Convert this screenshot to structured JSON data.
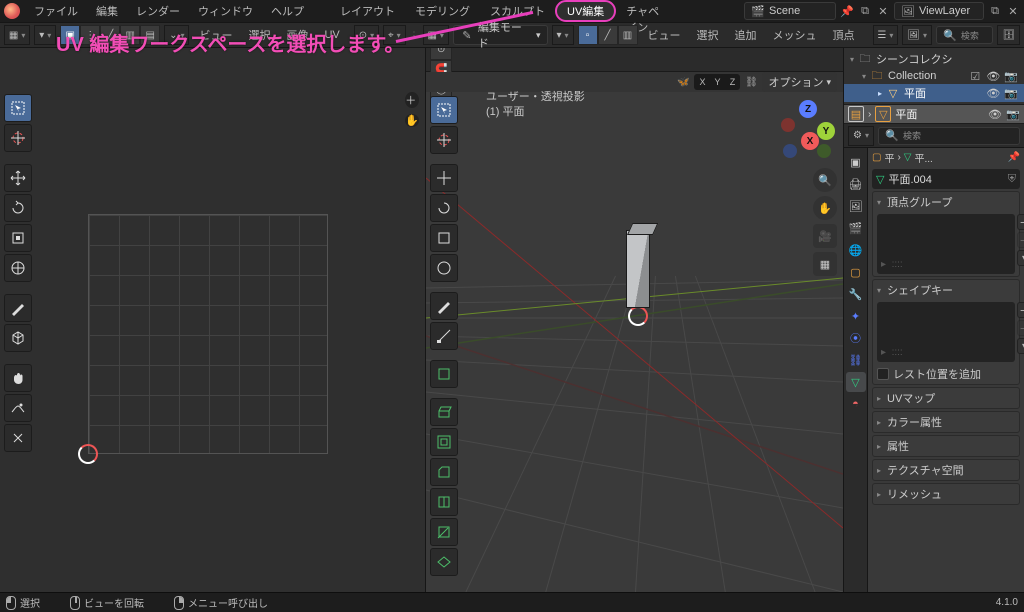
{
  "menu": {
    "file": "ファイル",
    "edit": "編集",
    "render": "レンダー",
    "window": "ウィンドウ",
    "help": "ヘルプ"
  },
  "workspaces": {
    "layout": "レイアウト",
    "modeling": "モデリング",
    "sculpt": "スカルプト",
    "uv": "UV編集",
    "texpaint": "テクスチャペイン"
  },
  "scene": {
    "label": "Scene"
  },
  "viewlayer": {
    "label": "ViewLayer"
  },
  "uv_header": {
    "view": "ビュー",
    "select": "選択",
    "image": "画像",
    "uv": "UV"
  },
  "vp_header": {
    "mode": "編集モード",
    "view": "ビュー",
    "select": "選択",
    "add": "追加",
    "mesh": "メッシュ",
    "vertex": "頂点"
  },
  "options_label": "オプション",
  "axes": {
    "x": "X",
    "y": "Y",
    "z": "Z"
  },
  "viewport": {
    "title": "ユーザー・透視投影",
    "object": "(1) 平面"
  },
  "outliner": {
    "search_placeholder": "検索",
    "scene_coll": "シーンコレクシ",
    "collection": "Collection",
    "object": "平面"
  },
  "new_editor": {
    "name": "平面"
  },
  "props_tabs": [
    "render",
    "output",
    "viewlayer",
    "scene",
    "world",
    "object",
    "modifier",
    "particles",
    "physics",
    "constraint",
    "data",
    "material",
    "texture"
  ],
  "props": {
    "search_placeholder": "検索",
    "crumb_obj": "平",
    "crumb_mesh": "平...",
    "name": "平面.004",
    "vgroups": "頂点グループ",
    "shapekeys": "シェイプキー",
    "rest": "レスト位置を追加",
    "uvmaps": "UVマップ",
    "colorattr": "カラー属性",
    "attrs": "属性",
    "texspace": "テクスチャ空間",
    "remesh": "リメッシュ"
  },
  "status": {
    "select": "選択",
    "rotate": "ビューを回転",
    "menu": "メニュー呼び出し",
    "version": "4.1.0"
  },
  "annotation": "UV 編集ワークスペースを選択します。"
}
